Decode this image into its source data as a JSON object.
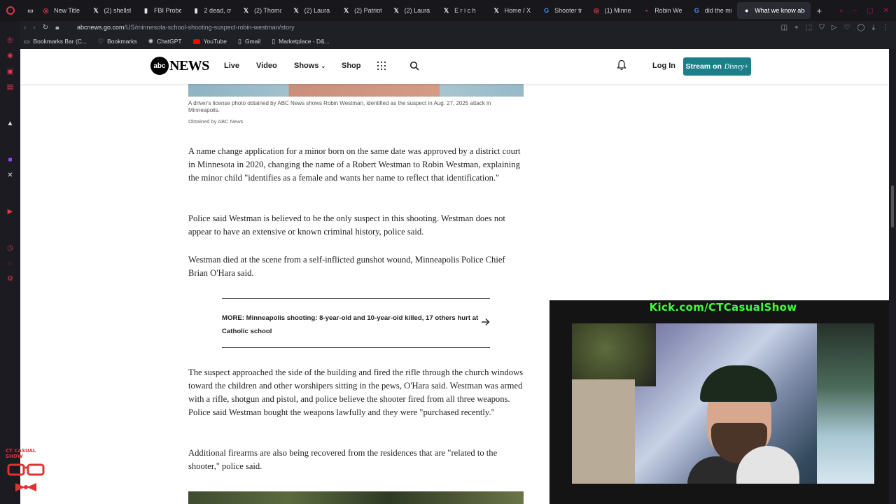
{
  "browser": {
    "tabs": [
      {
        "title": "New Title",
        "icon": "opera-icon"
      },
      {
        "title": "(2) shellsh",
        "icon": "x-icon"
      },
      {
        "title": "FBI Probe",
        "icon": "bookmark-icon"
      },
      {
        "title": "2 dead, ov",
        "icon": "bookmark-icon"
      },
      {
        "title": "(2) Thoma",
        "icon": "x-icon"
      },
      {
        "title": "(2) Laura L",
        "icon": "x-icon"
      },
      {
        "title": "(2) Patriot",
        "icon": "x-icon"
      },
      {
        "title": "(2) Laura L",
        "icon": "x-icon"
      },
      {
        "title": "E r i c h",
        "icon": "x-icon"
      },
      {
        "title": "Home / X",
        "icon": "x-icon"
      },
      {
        "title": "Shooter tr",
        "icon": "google-icon"
      },
      {
        "title": "(1) Minnea",
        "icon": "opera-icon"
      },
      {
        "title": "Robin Wes",
        "icon": "news-icon"
      },
      {
        "title": "did the mi",
        "icon": "google-icon"
      },
      {
        "title": "What we know abou",
        "icon": "abc-icon",
        "active": true
      }
    ],
    "url": {
      "host": "abcnews.go.com",
      "path": "/US/minnesota-school-shooting-suspect-robin-westman/story"
    },
    "bookmarks": [
      {
        "label": "Bookmarks Bar (C...",
        "icon": "folder-icon"
      },
      {
        "label": "Bookmarks",
        "icon": "heart-icon"
      },
      {
        "label": "ChatGPT",
        "icon": "chatgpt-icon"
      },
      {
        "label": "YouTube",
        "icon": "youtube-icon"
      },
      {
        "label": "Gmail",
        "icon": "doc-icon"
      },
      {
        "label": "Marketplace - D&...",
        "icon": "doc-icon"
      }
    ]
  },
  "site": {
    "logo_circle": "abc",
    "logo_word": "NEWS",
    "nav": [
      "Live",
      "Video",
      "Shows",
      "Shop"
    ],
    "login": "Log In",
    "stream_label": "Stream on",
    "stream_brand": "Disney+"
  },
  "article": {
    "caption": "A driver's license photo obtained by ABC News shows Robin Westman, identified as the suspect in Aug. 27, 2025 attack in Minneapolis.",
    "credit": "Obtained by ABC News",
    "paragraphs": [
      "A name change application for a minor born on the same date was approved by a district court in Minnesota in 2020, changing the name of a Robert Westman to Robin Westman, explaining the minor child \"identifies as a female and wants her name to reflect that identification.\"",
      "Police said Westman is believed to be the only suspect in this shooting. Westman does not appear to have an extensive or known criminal history, police said.",
      "Westman died at the scene from a self-inflicted gunshot wound, Minneapolis Police Chief Brian O'Hara said.",
      "The suspect approached the side of the building and fired the rifle through the church windows toward the children and other worshipers sitting in the pews, O'Hara said. Westman was armed with a rifle, shotgun and pistol, and police believe the shooter fired from all three weapons. Police said Westman bought the weapons lawfully and they were \"purchased recently.\"",
      "Additional firearms are also being recovered from the residences that are \"related to the shooter,\" police said."
    ],
    "more_link": "MORE: Minneapolis shooting: 8-year-old and 10-year-old killed, 17 others hurt at Catholic school"
  },
  "overlay": {
    "banner": "Kick.com/CTCasualShow",
    "corner_logo": "CT CASUAL SHOW"
  }
}
